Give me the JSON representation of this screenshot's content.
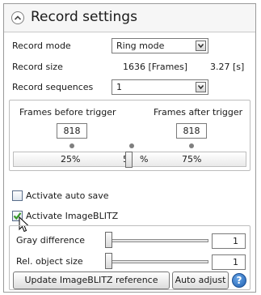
{
  "panel": {
    "title": "Record settings"
  },
  "record_mode": {
    "label": "Record mode",
    "value": "Ring mode"
  },
  "record_size": {
    "label": "Record size",
    "frames": "1636 [Frames]",
    "seconds": "3.27 [s]"
  },
  "record_sequences": {
    "label": "Record sequences",
    "value": "1"
  },
  "trigger": {
    "before_label": "Frames before trigger",
    "after_label": "Frames after trigger",
    "before_value": "818",
    "after_value": "818",
    "marks": [
      "25%",
      "50%",
      "75%"
    ],
    "marks_display": {
      "left": "25%",
      "mid_left": "5",
      "mid_right": "%",
      "right": "75%"
    },
    "position_fraction": 0.5
  },
  "auto_save": {
    "label": "Activate auto save",
    "checked": false
  },
  "imageblitz": {
    "label": "Activate ImageBLITZ",
    "checked": true
  },
  "gray_difference": {
    "label": "Gray difference",
    "value": "1",
    "slider_fraction": 0.0
  },
  "rel_object_size": {
    "label": "Rel. object size",
    "value": "1",
    "slider_fraction": 0.0
  },
  "buttons": {
    "update_reference": "Update ImageBLITZ reference",
    "auto_adjust": "Auto adjust",
    "help": "?"
  },
  "colors": {
    "check_green": "#3a9a2a",
    "help_blue": "#1f5fb0"
  }
}
